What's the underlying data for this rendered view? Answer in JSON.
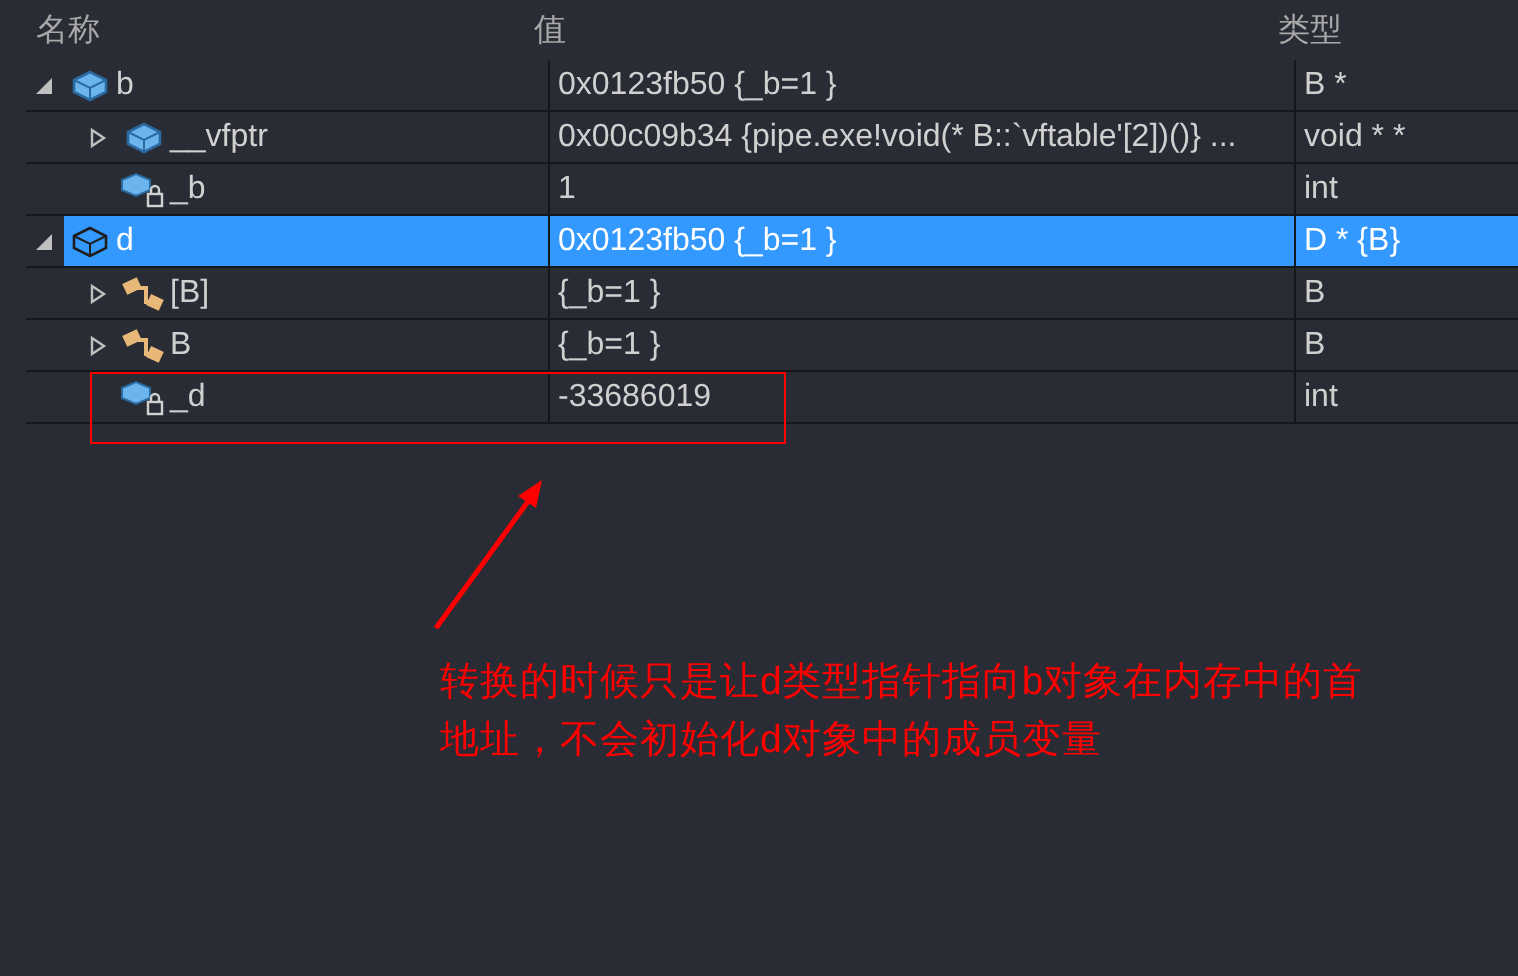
{
  "columns": [
    "名称",
    "值",
    "类型"
  ],
  "rows": [
    {
      "name": "b",
      "value": "0x0123fb50 {_b=1 }",
      "type": "B *",
      "kind": "object",
      "expanded": true,
      "selected": false,
      "children": [
        {
          "name": "__vfptr",
          "value": "0x00c09b34 {pipe.exe!void(* B::`vftable'[2])()} ...",
          "type": "void * *",
          "kind": "object",
          "expanded": false,
          "selected": false
        },
        {
          "name": "_b",
          "value": "1",
          "type": "int",
          "kind": "private-field",
          "selected": false
        }
      ]
    },
    {
      "name": "d",
      "value": "0x0123fb50 {_b=1 }",
      "type": "D * {B}",
      "kind": "object",
      "expanded": true,
      "selected": true,
      "children": [
        {
          "name": "[B]",
          "value": "{_b=1 }",
          "type": "B",
          "kind": "base-class",
          "expanded": false,
          "selected": false
        },
        {
          "name": "B",
          "value": "{_b=1 }",
          "type": "B",
          "kind": "base-class",
          "expanded": false,
          "selected": false
        },
        {
          "name": "_d",
          "value": "-33686019",
          "type": "int",
          "kind": "private-field",
          "selected": false
        }
      ]
    }
  ],
  "annotation": {
    "note": "转换的时候只是让d类型指针指向b对象在内存中的首地址，不会初始化d对象中的成员变量"
  }
}
